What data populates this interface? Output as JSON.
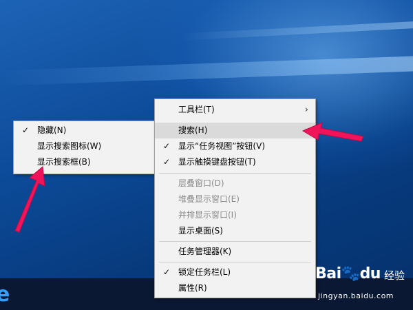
{
  "main_menu": {
    "items": [
      {
        "label": "工具栏(T)",
        "check": "",
        "arrow": "›",
        "highlight": false,
        "disabled": false
      },
      {
        "label": "搜索(H)",
        "check": "",
        "arrow": "›",
        "highlight": true,
        "disabled": false
      },
      {
        "label": "显示“任务视图”按钮(V)",
        "check": "✓",
        "arrow": "",
        "highlight": false,
        "disabled": false
      },
      {
        "label": "显示触摸键盘按钮(T)",
        "check": "✓",
        "arrow": "",
        "highlight": false,
        "disabled": false
      },
      {
        "label": "层叠窗口(D)",
        "check": "",
        "arrow": "",
        "highlight": false,
        "disabled": true
      },
      {
        "label": "堆叠显示窗口(E)",
        "check": "",
        "arrow": "",
        "highlight": false,
        "disabled": true
      },
      {
        "label": "并排显示窗口(I)",
        "check": "",
        "arrow": "",
        "highlight": false,
        "disabled": true
      },
      {
        "label": "显示桌面(S)",
        "check": "",
        "arrow": "",
        "highlight": false,
        "disabled": false
      },
      {
        "label": "任务管理器(K)",
        "check": "",
        "arrow": "",
        "highlight": false,
        "disabled": false
      },
      {
        "label": "锁定任务栏(L)",
        "check": "✓",
        "arrow": "",
        "highlight": false,
        "disabled": false
      },
      {
        "label": "属性(R)",
        "check": "",
        "arrow": "",
        "highlight": false,
        "disabled": false
      }
    ]
  },
  "search_submenu": {
    "items": [
      {
        "label": "隐藏(N)",
        "check": "✓"
      },
      {
        "label": "显示搜索图标(W)",
        "check": ""
      },
      {
        "label": "显示搜索框(B)",
        "check": ""
      }
    ]
  },
  "watermark": {
    "logo": "Bai",
    "logo_paw": "🐾",
    "logo_du": "du",
    "jingyan": "经验",
    "url": "jingyan.baidu.com"
  },
  "colors": {
    "annotation_arrow": "#f0145a",
    "menu_bg": "#f2f2f2",
    "highlight_bg": "#dadada"
  },
  "icons": {
    "browser": "e"
  }
}
